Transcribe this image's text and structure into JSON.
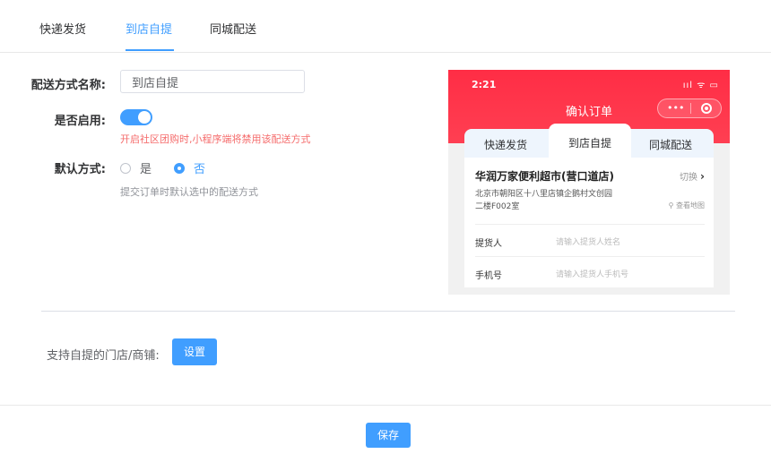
{
  "tabs": [
    {
      "label": "快递发货",
      "active": false
    },
    {
      "label": "到店自提",
      "active": true
    },
    {
      "label": "同城配送",
      "active": false
    }
  ],
  "form": {
    "name_label": "配送方式名称:",
    "name_value": "到店自提",
    "enable_label": "是否启用:",
    "enabled": true,
    "enable_hint": "开启社区团购时,小程序端将禁用该配送方式",
    "default_label": "默认方式:",
    "radio_yes": "是",
    "radio_no": "否",
    "default_selected": "否",
    "default_hint": "提交订单时默认选中的配送方式",
    "store_label": "支持自提的门店/商铺:",
    "settings_button": "设置"
  },
  "footer": {
    "save_button": "保存"
  },
  "colors": {
    "primary": "#409eff",
    "danger": "#f56c6c",
    "phone_header": "#ff2d45"
  },
  "phone": {
    "time": "2:21",
    "status_icons": "ııl ᯤ ▭",
    "title": "确认订单",
    "capsule_dots": "•••",
    "tabs": [
      "快递发货",
      "到店自提",
      "同城配送"
    ],
    "active_tab": "到店自提",
    "store_name": "华润万家便利超市(营口道店)",
    "switch_label": "切换",
    "switch_arrow": "›",
    "address_line1": "北京市朝阳区十八里店镇企鹅村文创园",
    "address_line2": "二楼F002室",
    "map_link": "查看地图",
    "pickup_label": "提货人",
    "pickup_placeholder": "请输入提货人姓名",
    "phone_label": "手机号",
    "phone_placeholder": "请输入提货人手机号"
  }
}
